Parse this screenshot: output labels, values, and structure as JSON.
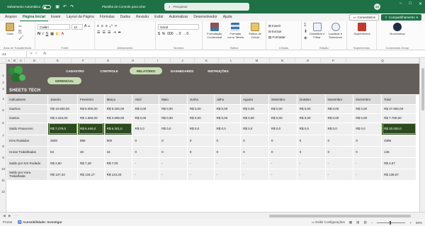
{
  "titlebar": {
    "autosave_label": "Salvamento Automático",
    "document_title": "Planilha de Controle para Uber",
    "search_placeholder": "Pesquisar",
    "user_initials": "AH"
  },
  "menu": {
    "tabs": [
      "Arquivo",
      "Página Inicial",
      "Inserir",
      "Layout da Página",
      "Fórmulas",
      "Dados",
      "Revisão",
      "Exibir",
      "Automatizar",
      "Desenvolvedor",
      "Ajuda"
    ],
    "active_index": 1,
    "comments_label": "Comentários",
    "share_label": "Compartilhamento"
  },
  "ribbon": {
    "paste_label": "Colar",
    "clipboard_label": "Área de Transferência",
    "font_name": "Calibri",
    "font_size": "12",
    "font_label": "Fonte",
    "alignment_label": "Alinhamento",
    "number_format": "Geral",
    "number_label": "Número",
    "cond_format_label": "Formatação Condicional",
    "format_table_label": "Formatar como Tabela",
    "cell_styles_label": "Estilos de Célula",
    "styles_label": "Estilos",
    "insert_label": "Inserir",
    "delete_label": "Excluir",
    "format_label": "Formatar",
    "cells_label": "Células",
    "sort_label": "Classificar e Filtrar",
    "find_label": "Localizar e Selecionar",
    "editing_label": "Edição",
    "addins_label": "Suplementos",
    "addins_group": "Suplementos",
    "nuvemshop_label": "Nuvemshop",
    "commands_label": "Commands Group"
  },
  "formula_bar": {
    "name_box": "A1",
    "fx": "fx"
  },
  "columns": [
    "A",
    "B",
    "C",
    "D",
    "E",
    "F",
    "G",
    "H",
    "I",
    "J",
    "K",
    "L",
    "M",
    "N",
    "O",
    "P",
    "Q"
  ],
  "rows": [
    "1",
    "2",
    "3",
    "4",
    "5",
    "6",
    "7",
    "8",
    "9",
    "10",
    "11",
    "12"
  ],
  "dashboard": {
    "logo_text": "SHEETS TECH",
    "nav": [
      "CADASTRO",
      "CONTROLE",
      "RELATÓRIO",
      "DASHBOARDS",
      "INSTRUÇÕES"
    ],
    "nav_active": "RELATÓRIO",
    "subnav": "GERENCIAL"
  },
  "report": {
    "headers": [
      "Indicadores",
      "Janeiro",
      "Fevereiro",
      "Março",
      "Abril",
      "Maio",
      "Junho",
      "Julho",
      "Agosto",
      "Setembro",
      "Outubro",
      "Novembro",
      "Dezembro",
      "Total"
    ],
    "rows": [
      {
        "label": "Ganhos",
        "values": [
          "R$ 10.600,00",
          "R$ 8.000,00",
          "R$ 9.200,00",
          "R$ 0,00",
          "R$ 0,00",
          "R$ 0,00",
          "R$ 0,00",
          "R$ 0,00",
          "R$ 0,00",
          "R$ 0,00",
          "R$ 0,00",
          "R$ 0,00",
          "R$ 27.800,00"
        ]
      },
      {
        "label": "Gastos",
        "values": [
          "R$ 3.323,00",
          "R$ 1.560,00",
          "R$ 2.899,00",
          "R$ 0,00",
          "R$ 0,00",
          "R$ 0,00",
          "R$ 0,00",
          "R$ 0,00",
          "R$ 0,00",
          "R$ 0,00",
          "R$ 0,00",
          "R$ 0,00",
          "R$ 7.780,00"
        ]
      },
      {
        "label": "Saldo Financeiro",
        "values": [
          "R$ 7.279,0",
          "R$ 6.440,0",
          "R$ 6.301,0",
          "R$ 0,0",
          "R$ 0,0",
          "R$ 0,0",
          "R$ 0,0",
          "R$ 0,0",
          "R$ 0,0",
          "R$ 0,0",
          "R$ 0,0",
          "R$ 0,0",
          "R$ 20.020,0"
        ]
      },
      {
        "label": "Kms Rodados",
        "values": [
          "2600",
          "885",
          "900",
          "0",
          "0",
          "0",
          "0",
          "0",
          "0",
          "0",
          "0",
          "0",
          "4385"
        ]
      },
      {
        "label": "Horas Trabalhadas",
        "values": [
          "53",
          "48",
          "44",
          "0",
          "0",
          "0",
          "0",
          "0",
          "0",
          "0",
          "0",
          "0",
          "145"
        ]
      },
      {
        "label": "Saldo por Km Rodado",
        "values": [
          "R$ 2,80",
          "R$ 7,28",
          "R$ 7,00",
          "-",
          "-",
          "-",
          "-",
          "-",
          "-",
          "-",
          "-",
          "-",
          "R$ 4,57"
        ]
      },
      {
        "label": "Saldo por Hora Trabalhada",
        "values": [
          "R$ 137,34",
          "R$ 134,17",
          "R$ 143,20",
          "-",
          "-",
          "-",
          "-",
          "-",
          "-",
          "-",
          "-",
          "-",
          "R$ 138,07"
        ]
      }
    ]
  },
  "status": {
    "ready": "Pronto",
    "accessibility": "Acessibilidade: Investigar",
    "display_settings": "Exibir Configurações",
    "zoom": "90%"
  }
}
